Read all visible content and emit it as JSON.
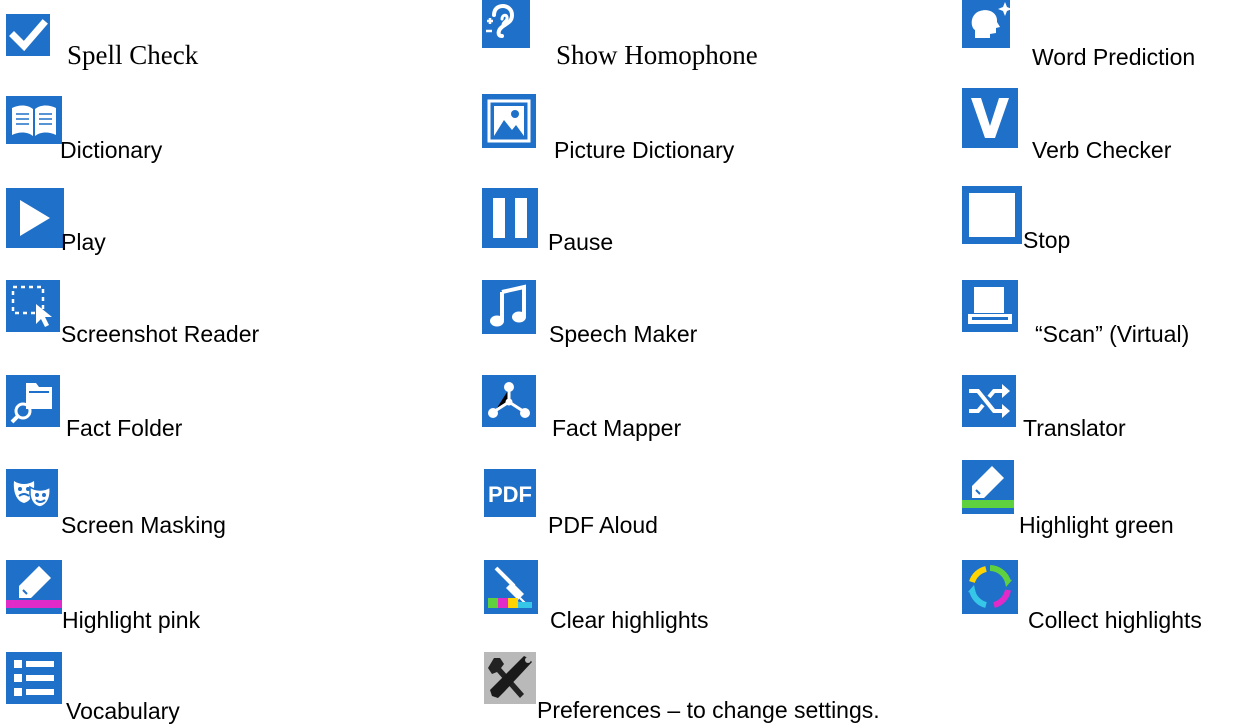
{
  "colors": {
    "icon_blue": "#1f70c9",
    "icon_blue_dark": "#155aa8",
    "icon_white": "#ffffff",
    "highlight_green": "#5fd13e",
    "highlight_pink": "#e02bc9",
    "preferences_gray": "#b9b9b9",
    "text": "#000000"
  },
  "legend": {
    "spell_check": {
      "label": "Spell Check",
      "icon": "checkmark-icon"
    },
    "show_homophone": {
      "label": "Show Homophone",
      "icon": "ear-icon"
    },
    "word_prediction": {
      "label": "Word Prediction",
      "icon": "head-sparkle-icon"
    },
    "dictionary": {
      "label": "Dictionary",
      "icon": "open-book-icon"
    },
    "picture_dictionary": {
      "label": "Picture Dictionary",
      "icon": "picture-icon"
    },
    "verb_checker": {
      "label": "Verb Checker",
      "icon": "letter-v-icon"
    },
    "play": {
      "label": "Play",
      "icon": "play-icon"
    },
    "pause": {
      "label": "Pause",
      "icon": "pause-icon"
    },
    "stop": {
      "label": "Stop",
      "icon": "stop-icon"
    },
    "screenshot_reader": {
      "label": "Screenshot Reader",
      "icon": "screenshot-select-icon"
    },
    "speech_maker": {
      "label": "Speech Maker",
      "icon": "music-note-icon"
    },
    "scan_virtual": {
      "label": "“Scan” (Virtual)",
      "icon": "scanner-icon"
    },
    "fact_folder": {
      "label": "Fact Folder",
      "icon": "folder-search-icon"
    },
    "fact_mapper": {
      "label": "Fact Mapper",
      "icon": "node-map-icon"
    },
    "translator": {
      "label": "Translator",
      "icon": "shuffle-arrows-icon"
    },
    "screen_masking": {
      "label": "Screen Masking",
      "icon": "theatre-masks-icon"
    },
    "pdf_aloud": {
      "label": "PDF Aloud",
      "icon": "pdf-icon",
      "icon_text": "PDF"
    },
    "highlight_green": {
      "label": "Highlight green",
      "icon": "green-highlighter-icon"
    },
    "highlight_pink": {
      "label": "Highlight pink",
      "icon": "pink-highlighter-icon"
    },
    "clear_highlights": {
      "label": "Clear highlights",
      "icon": "clear-highlights-brush-icon"
    },
    "collect_highlights": {
      "label": "Collect highlights",
      "icon": "collect-cycle-icon"
    },
    "vocabulary": {
      "label": "Vocabulary",
      "icon": "list-icon"
    },
    "preferences": {
      "label": "Preferences – to change settings.",
      "icon": "wrench-screwdriver-icon"
    }
  }
}
